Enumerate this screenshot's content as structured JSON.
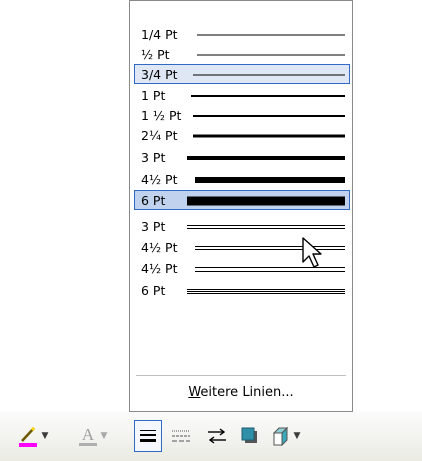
{
  "colors": {
    "highlight_bg": "#c1d2ee",
    "highlight_border": "#316ac5",
    "selected_faint_bg": "#dfe7f5",
    "font_color_bar": "#ff00ff"
  },
  "menu": {
    "items": [
      {
        "label": "1/4 Pt",
        "kind": "single",
        "weight": 1,
        "highlight": false
      },
      {
        "label": "½ Pt",
        "kind": "single",
        "weight": 1,
        "highlight": false
      },
      {
        "label": "3/4 Pt",
        "kind": "single",
        "weight": 1,
        "highlight": "faint"
      },
      {
        "label": "1 Pt",
        "kind": "single",
        "weight": 2,
        "highlight": false
      },
      {
        "label": "1 ½ Pt",
        "kind": "single",
        "weight": 2,
        "highlight": false
      },
      {
        "label": "2¼ Pt",
        "kind": "single",
        "weight": 3,
        "highlight": false
      },
      {
        "label": "3 Pt",
        "kind": "single",
        "weight": 4,
        "highlight": false
      },
      {
        "label": "4½ Pt",
        "kind": "single",
        "weight": 6,
        "highlight": false
      },
      {
        "label": "6 Pt",
        "kind": "single",
        "weight": 9,
        "highlight": "strong"
      },
      {
        "label": "3 Pt",
        "kind": "double",
        "weight": 2,
        "highlight": false
      },
      {
        "label": "4½ Pt",
        "kind": "double",
        "weight": 2,
        "highlight": false
      },
      {
        "label": "4½ Pt",
        "kind": "double",
        "weight": 3,
        "highlight": false
      },
      {
        "label": "6 Pt",
        "kind": "triple",
        "weight": 3,
        "highlight": false
      }
    ],
    "more_lines_label": "Weitere Linien..."
  },
  "toolbar": {
    "icons": [
      "line-color-pencil-icon",
      "font-color-icon",
      "line-style-icon",
      "dash-style-icon",
      "arrow-style-icon",
      "shadow-style-icon",
      "3d-style-icon"
    ],
    "font_color_letter": "A"
  }
}
